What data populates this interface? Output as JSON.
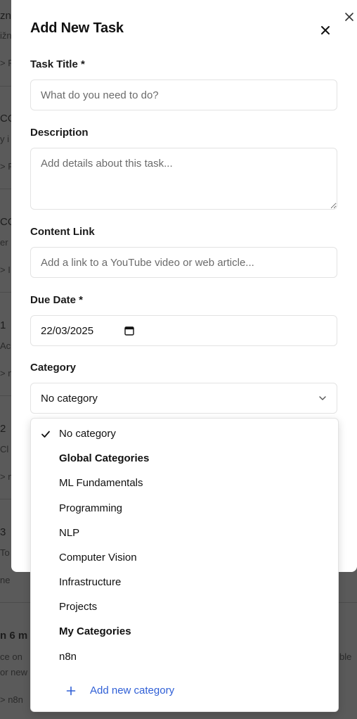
{
  "background": {
    "fragments": [
      "zn",
      "ižn",
      "> P",
      "CO",
      "y i",
      "> P",
      "CO",
      "er",
      "> I",
      "1",
      "Ac",
      "> n",
      "2",
      "Cl",
      "> n",
      "3",
      "To",
      "ne",
      "n 6 m",
      "ce on",
      "or new",
      "> n8n",
      "ble"
    ]
  },
  "modal": {
    "title": "Add New Task",
    "task_title": {
      "label": "Task Title *",
      "placeholder": "What do you need to do?"
    },
    "description": {
      "label": "Description",
      "placeholder": "Add details about this task..."
    },
    "content_link": {
      "label": "Content Link",
      "placeholder": "Add a link to a YouTube video or web article..."
    },
    "due_date": {
      "label": "Due Date *",
      "value": "22/03/2025"
    },
    "category": {
      "label": "Category",
      "selected": "No category"
    }
  },
  "dropdown": {
    "no_category": "No category",
    "global_header": "Global Categories",
    "global": [
      "ML Fundamentals",
      "Programming",
      "NLP",
      "Computer Vision",
      "Infrastructure",
      "Projects"
    ],
    "my_header": "My Categories",
    "mine": [
      "n8n"
    ],
    "add_label": "Add new category"
  },
  "colors": {
    "accent": "#2f5fd6",
    "overlay": "#5a5a5a"
  }
}
